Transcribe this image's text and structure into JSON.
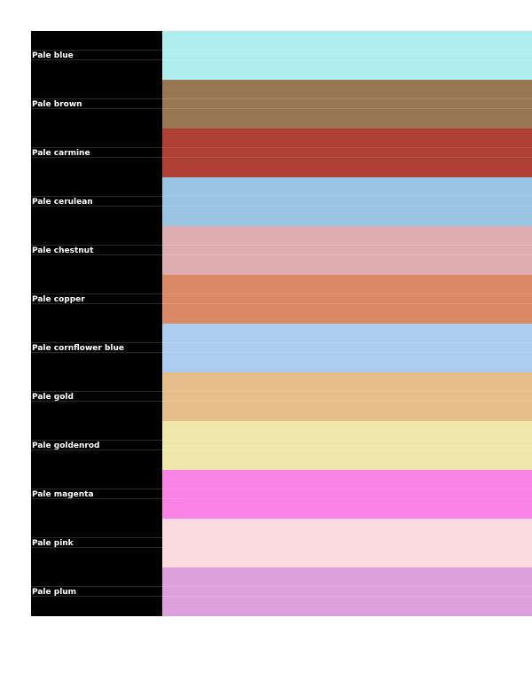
{
  "colors": [
    {
      "name": "Pale blue",
      "hex": "#afeeee"
    },
    {
      "name": "Pale brown",
      "hex": "#987654"
    },
    {
      "name": "Pale carmine",
      "hex": "#af4035"
    },
    {
      "name": "Pale cerulean",
      "hex": "#9bc4e2"
    },
    {
      "name": "Pale chestnut",
      "hex": "#ddadaf"
    },
    {
      "name": "Pale copper",
      "hex": "#da8a67"
    },
    {
      "name": "Pale cornflower blue",
      "hex": "#abcdef"
    },
    {
      "name": "Pale gold",
      "hex": "#e6be8a"
    },
    {
      "name": "Pale goldenrod",
      "hex": "#eee8aa"
    },
    {
      "name": "Pale magenta",
      "hex": "#f984e5"
    },
    {
      "name": "Pale pink",
      "hex": "#fadadd"
    },
    {
      "name": "Pale plum",
      "hex": "#dda0dd"
    }
  ]
}
